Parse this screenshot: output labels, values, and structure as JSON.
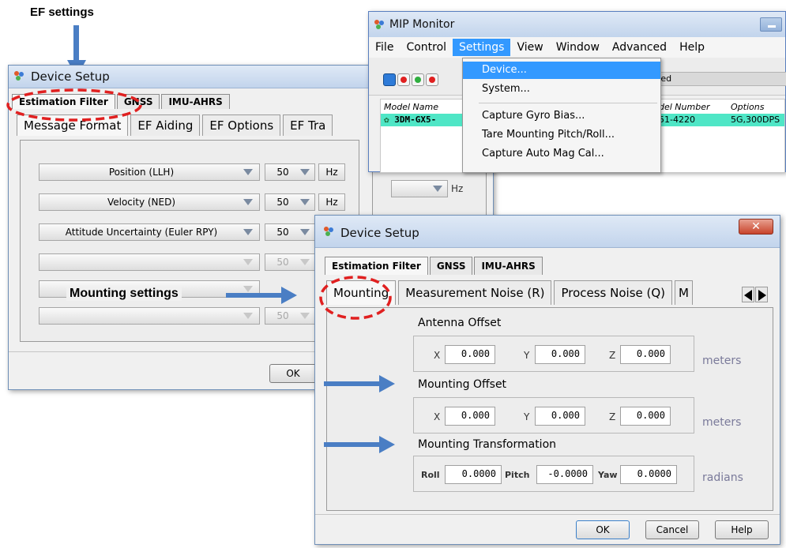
{
  "annotations": {
    "ef_settings": "EF settings",
    "mounting_settings": "Mounting settings"
  },
  "back_window": {
    "title": "Device Setup",
    "tabs": [
      "Estimation Filter",
      "GNSS",
      "IMU-AHRS"
    ],
    "subtabs": [
      "Message Format",
      "EF Aiding",
      "EF Options",
      "EF Tra"
    ],
    "rows": [
      {
        "label": "Position (LLH)",
        "rate": "50",
        "unit": "Hz"
      },
      {
        "label": "Velocity (NED)",
        "rate": "50",
        "unit": "Hz"
      },
      {
        "label": "Attitude Uncertainty (Euler RPY)",
        "rate": "50",
        "unit": "Hz"
      },
      {
        "label": "",
        "rate": "50",
        "unit": ""
      },
      {
        "label": "",
        "rate": "50",
        "unit": ""
      },
      {
        "label": "",
        "rate": "50",
        "unit": ""
      }
    ],
    "ok_label": "OK",
    "extra_unit": "Hz"
  },
  "mip_monitor": {
    "title": "MIP Monitor",
    "menu": [
      "File",
      "Control",
      "Settings",
      "View",
      "Window",
      "Advanced",
      "Help"
    ],
    "settings_menu": [
      "Device...",
      "System...",
      "Capture Gyro Bias...",
      "Tare Mounting Pitch/Roll...",
      "Capture Auto Mag Cal..."
    ],
    "toolbar_status": "ted",
    "columns": {
      "model_name": "Model Name",
      "model_number": "del Number",
      "options": "Options"
    },
    "row": {
      "model_name": "3DM-GX5-",
      "model_number": "51-4220",
      "options": "5G,300DPS"
    }
  },
  "front_window": {
    "title": "Device Setup",
    "tabs": [
      "Estimation Filter",
      "GNSS",
      "IMU-AHRS"
    ],
    "subtabs": [
      "Mounting",
      "Measurement Noise (R)",
      "Process Noise (Q)",
      "M"
    ],
    "antenna_offset": {
      "title": "Antenna Offset",
      "x_label": "X",
      "x": "0.000",
      "y_label": "Y",
      "y": "0.000",
      "z_label": "Z",
      "z": "0.000",
      "unit": "meters"
    },
    "mounting_offset": {
      "title": "Mounting Offset",
      "x_label": "X",
      "x": "0.000",
      "y_label": "Y",
      "y": "0.000",
      "z_label": "Z",
      "z": "0.000",
      "unit": "meters"
    },
    "mounting_transformation": {
      "title": "Mounting Transformation",
      "roll_label": "Roll",
      "roll": "0.0000",
      "pitch_label": "Pitch",
      "pitch": "-0.0000",
      "yaw_label": "Yaw",
      "yaw": "0.0000",
      "unit": "radians"
    },
    "buttons": {
      "ok": "OK",
      "cancel": "Cancel",
      "help": "Help"
    }
  },
  "colors": {
    "accent_blue": "#4a7ec4",
    "dash_red": "#e02020",
    "selected_row": "#4fe6c6",
    "menu_highlight": "#3399ff"
  },
  "icons": [
    "app-icon",
    "close-icon",
    "arrow-left-icon",
    "arrow-right-icon",
    "dropdown-arrow-icon",
    "record-icon",
    "stop-icon",
    "play-icon"
  ]
}
